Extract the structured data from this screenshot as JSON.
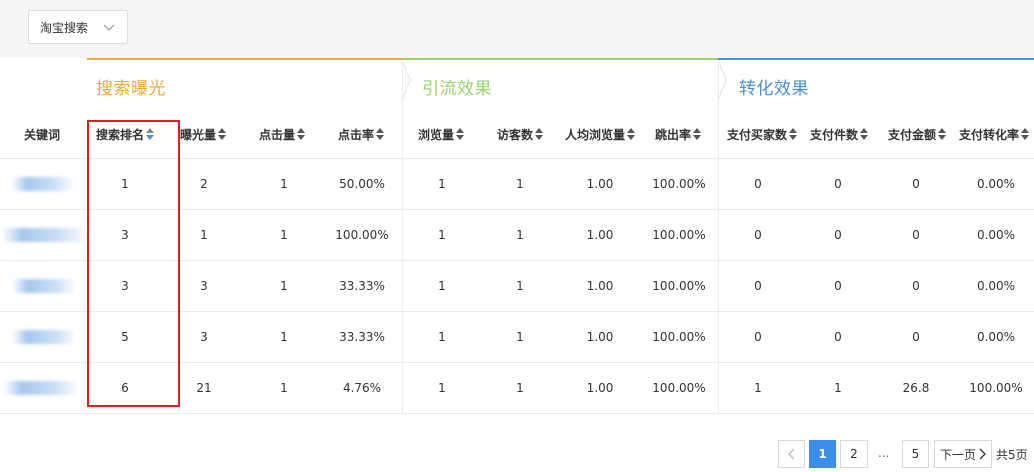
{
  "filter": {
    "selected": "淘宝搜索"
  },
  "groups": [
    {
      "title": "搜索曝光",
      "color": "#f0a93b"
    },
    {
      "title": "引流效果",
      "color": "#9bd36b"
    },
    {
      "title": "转化效果",
      "color": "#4a90d9"
    }
  ],
  "columns": {
    "keyword": "关键词",
    "rank": "搜索排名",
    "impressions": "曝光量",
    "clicks": "点击量",
    "ctr": "点击率",
    "pageviews": "浏览量",
    "visitors": "访客数",
    "avg_pv": "人均浏览量",
    "bounce": "跳出率",
    "buyers": "支付买家数",
    "items": "支付件数",
    "amount": "支付金额",
    "conv": "支付转化率"
  },
  "rows": [
    {
      "rank": "1",
      "impressions": "2",
      "clicks": "1",
      "ctr": "50.00%",
      "pageviews": "1",
      "visitors": "1",
      "avg_pv": "1.00",
      "bounce": "100.00%",
      "buyers": "0",
      "items": "0",
      "amount": "0",
      "conv": "0.00%"
    },
    {
      "rank": "3",
      "impressions": "1",
      "clicks": "1",
      "ctr": "100.00%",
      "pageviews": "1",
      "visitors": "1",
      "avg_pv": "1.00",
      "bounce": "100.00%",
      "buyers": "0",
      "items": "0",
      "amount": "0",
      "conv": "0.00%"
    },
    {
      "rank": "3",
      "impressions": "3",
      "clicks": "1",
      "ctr": "33.33%",
      "pageviews": "1",
      "visitors": "1",
      "avg_pv": "1.00",
      "bounce": "100.00%",
      "buyers": "0",
      "items": "0",
      "amount": "0",
      "conv": "0.00%"
    },
    {
      "rank": "5",
      "impressions": "3",
      "clicks": "1",
      "ctr": "33.33%",
      "pageviews": "1",
      "visitors": "1",
      "avg_pv": "1.00",
      "bounce": "100.00%",
      "buyers": "0",
      "items": "0",
      "amount": "0",
      "conv": "0.00%"
    },
    {
      "rank": "6",
      "impressions": "21",
      "clicks": "1",
      "ctr": "4.76%",
      "pageviews": "1",
      "visitors": "1",
      "avg_pv": "1.00",
      "bounce": "100.00%",
      "buyers": "1",
      "items": "1",
      "amount": "26.8",
      "conv": "100.00%"
    }
  ],
  "pagination": {
    "pages": [
      "1",
      "2",
      "...",
      "5"
    ],
    "current": "1",
    "next_label": "下一页",
    "total_label": "共5页"
  }
}
